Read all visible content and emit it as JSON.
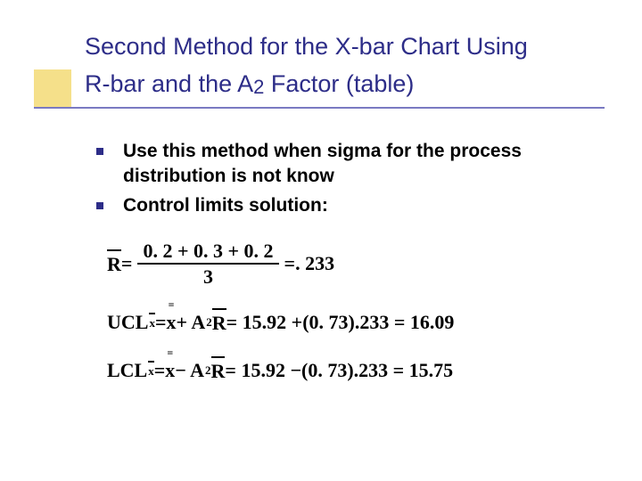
{
  "title": {
    "line1a": "Second Method for the X-bar Chart Using",
    "line2a": "R-bar and the A",
    "sub": "2",
    "line2b": " Factor (table)"
  },
  "bullets": [
    "Use this method when sigma for the process distribution is not know",
    "Control limits solution:"
  ],
  "formulas": {
    "rbar": {
      "lhs": "R",
      "eq": " = ",
      "num": "0. 2 + 0. 3 + 0. 2",
      "den": "3",
      "eq2": " = ",
      "rhs": ". 233"
    },
    "ucl": {
      "label": "UCL",
      "sub": "x",
      "eq": " = ",
      "x": "x",
      "op": " + A",
      "asub": "2",
      "sp": " ",
      "r": "R",
      "eq2": " = 15.92 + ",
      "lp": "(",
      "a2": "0. 73",
      "rp": ")",
      "rv": ".233 = 16.09"
    },
    "lcl": {
      "label": "LCL",
      "sub": "x",
      "eq": " = ",
      "x": "x",
      "op": " − A",
      "asub": "2",
      "sp": " ",
      "r": "R",
      "eq2": " = 15.92 − ",
      "lp": "(",
      "a2": "0. 73",
      "rp": ")",
      "rv": ".233 = 15.75"
    }
  },
  "chart_data": {
    "type": "table",
    "title": "X-bar chart control limits via R-bar and A2",
    "ranges": [
      0.2,
      0.3,
      0.2
    ],
    "n_samples": 3,
    "Rbar": 0.233,
    "xbarbar": 15.92,
    "A2": 0.73,
    "UCL_x": 16.09,
    "LCL_x": 15.75
  }
}
